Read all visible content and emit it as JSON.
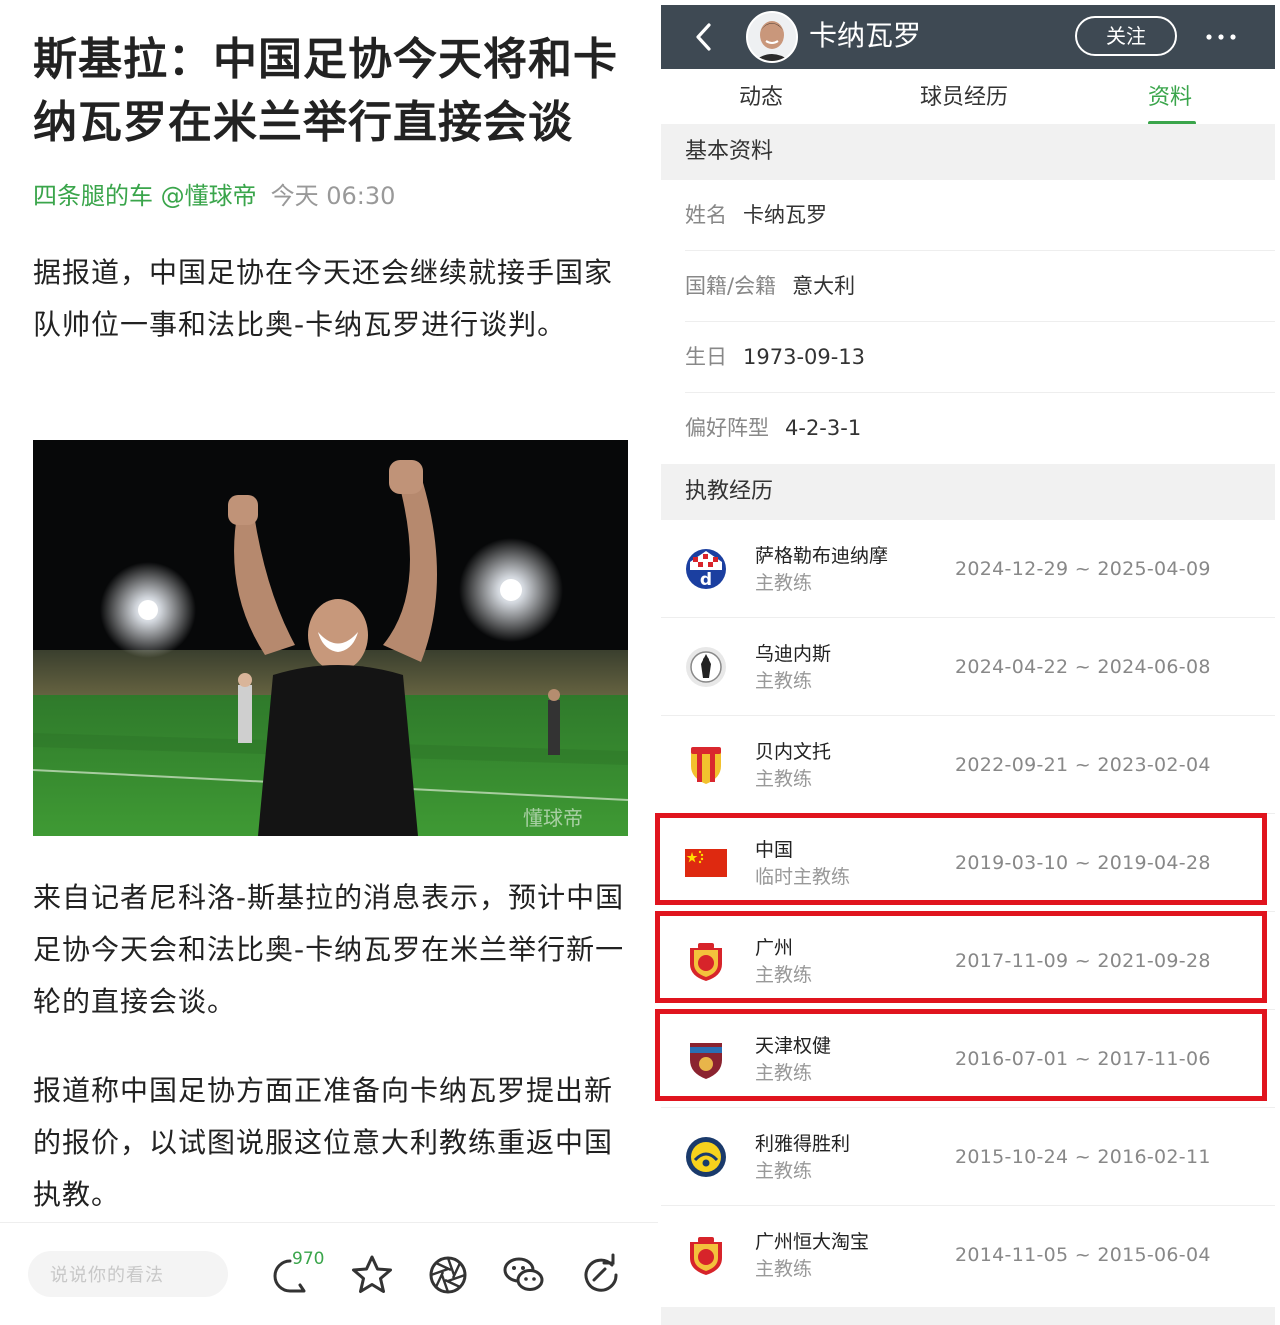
{
  "article": {
    "title": "斯基拉：中国足协今天将和卡纳瓦罗在米兰举行直接会谈",
    "author": "四条腿的车 @懂球帝",
    "time": "今天 06:30",
    "paragraphs": [
      "据报道，中国足协在今天还会继续就接手国家队帅位一事和法比奥-卡纳瓦罗进行谈判。",
      "来自记者尼科洛-斯基拉的消息表示，预计中国足协今天会和法比奥-卡纳瓦罗在米兰举行新一轮的直接会谈。",
      "报道称中国足协方面正准备向卡纳瓦罗提出新的报价，以试图说服这位意大利教练重返中国执教。"
    ],
    "photo_watermark": "懂球帝",
    "bottom_bar": {
      "comment_placeholder": "说说你的看法",
      "comment_count": "970",
      "icons": [
        "comment-icon",
        "star-icon",
        "share-icon",
        "wechat-icon",
        "repost-icon"
      ]
    }
  },
  "profile": {
    "name": "卡纳瓦罗",
    "follow_label": "关注",
    "tabs": [
      "动态",
      "球员经历",
      "资料"
    ],
    "active_tab": "资料",
    "basic_section_title": "基本资料",
    "basic_info": [
      {
        "label": "姓名",
        "value": "卡纳瓦罗"
      },
      {
        "label": "国籍/会籍",
        "value": "意大利"
      },
      {
        "label": "生日",
        "value": "1973-09-13"
      },
      {
        "label": "偏好阵型",
        "value": "4-2-3-1"
      }
    ],
    "coaching_section_title": "执教经历",
    "coaching": [
      {
        "team": "萨格勒布迪纳摩",
        "role": "主教练",
        "dates": "2024-12-29 ~ 2025-04-09",
        "logo": "dinamo-zagreb-logo",
        "highlighted": false
      },
      {
        "team": "乌迪内斯",
        "role": "主教练",
        "dates": "2024-04-22 ~ 2024-06-08",
        "logo": "udinese-logo",
        "highlighted": false
      },
      {
        "team": "贝内文托",
        "role": "主教练",
        "dates": "2022-09-21 ~ 2023-02-04",
        "logo": "benevento-logo",
        "highlighted": false
      },
      {
        "team": "中国",
        "role": "临时主教练",
        "dates": "2019-03-10 ~ 2019-04-28",
        "logo": "china-flag",
        "highlighted": true
      },
      {
        "team": "广州",
        "role": "主教练",
        "dates": "2017-11-09 ~ 2021-09-28",
        "logo": "guangzhou-logo",
        "highlighted": true
      },
      {
        "team": "天津权健",
        "role": "主教练",
        "dates": "2016-07-01 ~ 2017-11-06",
        "logo": "tianjin-quanjian-logo",
        "highlighted": true
      },
      {
        "team": "利雅得胜利",
        "role": "主教练",
        "dates": "2015-10-24 ~ 2016-02-11",
        "logo": "al-nassr-logo",
        "highlighted": false
      },
      {
        "team": "广州恒大淘宝",
        "role": "主教练",
        "dates": "2014-11-05 ~ 2015-06-04",
        "logo": "guangzhou-evergrande-logo",
        "highlighted": false
      }
    ],
    "colors": {
      "accent": "#3aa54b",
      "header": "#3e4953",
      "highlight": "#e0141e"
    }
  }
}
